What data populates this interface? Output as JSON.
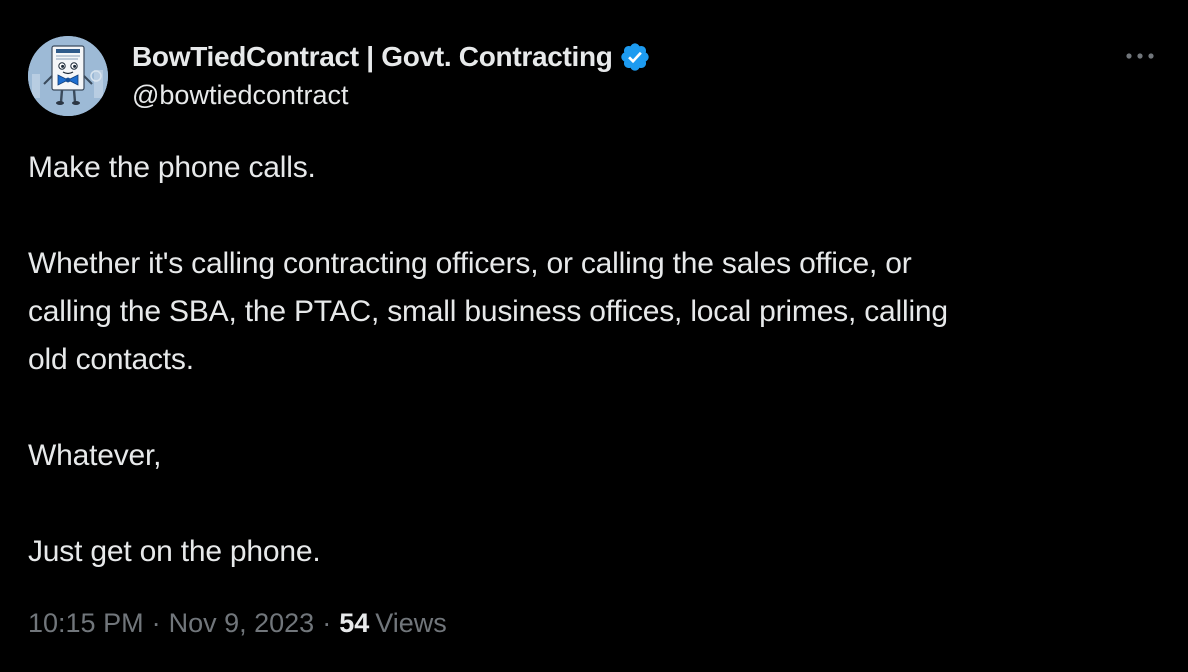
{
  "author": {
    "display_name": "BowTiedContract | Govt. Contracting",
    "handle": "@bowtiedcontract",
    "avatar_icon": "bowtie-contract-mascot-icon",
    "verified_icon": "verified-badge-icon",
    "verified_color": "#1d9bf0"
  },
  "tweet": {
    "paragraphs": [
      "Make the phone calls.",
      "Whether it's calling contracting officers, or calling the sales office, or\ncalling the SBA, the PTAC, small business offices, local primes, calling\nold contacts.",
      "Whatever,",
      "Just get on the phone."
    ]
  },
  "meta": {
    "time": "10:15 PM",
    "separator": "·",
    "date": "Nov 9, 2023",
    "views_count": "54",
    "views_label": "Views"
  },
  "more_icon": "more-options-icon",
  "colors": {
    "background": "#000000",
    "primary_text": "#e7e9ea",
    "secondary_text": "#71767b"
  }
}
